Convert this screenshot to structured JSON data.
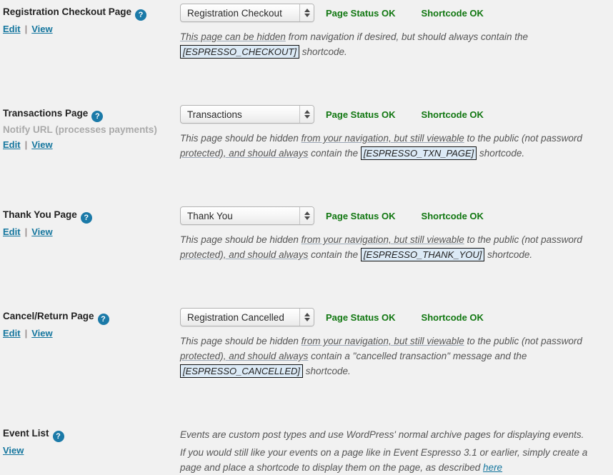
{
  "icons": {
    "help": "?",
    "help_name": "help-icon"
  },
  "colors": {
    "status_green": "#117711",
    "link_blue": "#15769e",
    "code_bg": "#dceaf6"
  },
  "labels": {
    "edit": "Edit",
    "view": "View",
    "separator": "|"
  },
  "rows": [
    {
      "title": "Registration Checkout Page",
      "subtitle": "",
      "select_value": "Registration Checkout",
      "page_status": "Page Status OK",
      "shortcode_status": "Shortcode OK",
      "desc_parts": [
        {
          "type": "underline",
          "text": "This page can be hidden"
        },
        {
          "type": "text",
          "text": " from navigation if desired, but should always contain the "
        },
        {
          "type": "code",
          "text": "[ESPRESSO_CHECKOUT]"
        },
        {
          "type": "text",
          "text": " shortcode."
        }
      ]
    },
    {
      "title": "Transactions Page",
      "subtitle": "Notify URL (processes payments)",
      "select_value": "Transactions",
      "page_status": "Page Status OK",
      "shortcode_status": "Shortcode OK",
      "desc_parts": [
        {
          "type": "text",
          "text": "This page should be hidden "
        },
        {
          "type": "underline",
          "text": "from your navigation, but still viewable"
        },
        {
          "type": "text",
          "text": " to the public (not password "
        },
        {
          "type": "underline",
          "text": "protected), and should always"
        },
        {
          "type": "text",
          "text": " contain the "
        },
        {
          "type": "code",
          "text": "[ESPRESSO_TXN_PAGE]"
        },
        {
          "type": "text",
          "text": " shortcode."
        }
      ]
    },
    {
      "title": "Thank You Page",
      "subtitle": "",
      "select_value": "Thank You",
      "page_status": "Page Status OK",
      "shortcode_status": "Shortcode OK",
      "desc_parts": [
        {
          "type": "text",
          "text": "This page should be hidden "
        },
        {
          "type": "underline",
          "text": "from your navigation, but still viewable"
        },
        {
          "type": "text",
          "text": " to the public (not password "
        },
        {
          "type": "underline",
          "text": "protected), and should always"
        },
        {
          "type": "text",
          "text": " contain the "
        },
        {
          "type": "code",
          "text": "[ESPRESSO_THANK_YOU]"
        },
        {
          "type": "text",
          "text": " shortcode."
        }
      ]
    },
    {
      "title": "Cancel/Return Page",
      "subtitle": "",
      "select_value": "Registration Cancelled",
      "page_status": "Page Status OK",
      "shortcode_status": "Shortcode OK",
      "desc_parts": [
        {
          "type": "text",
          "text": "This page should be hidden "
        },
        {
          "type": "underline",
          "text": "from your navigation, but still viewable"
        },
        {
          "type": "text",
          "text": " to the public (not password "
        },
        {
          "type": "underline",
          "text": "protected), and should always"
        },
        {
          "type": "text",
          "text": " contain a \"cancelled transaction\" message and the "
        },
        {
          "type": "code",
          "text": "[ESPRESSO_CANCELLED]"
        },
        {
          "type": "text",
          "text": " shortcode."
        }
      ]
    }
  ],
  "event_list": {
    "title": "Event List",
    "view_label": "View",
    "desc_line1": "Events are custom post types and use WordPress' normal archive pages for displaying events.",
    "desc_line2_parts": [
      {
        "type": "text",
        "text": "If you would still like your events on a page like in Event Espresso 3.1 or earlier, simply create a page and place a shortcode to display them on the page, as described "
      },
      {
        "type": "link",
        "text": "here"
      }
    ]
  }
}
